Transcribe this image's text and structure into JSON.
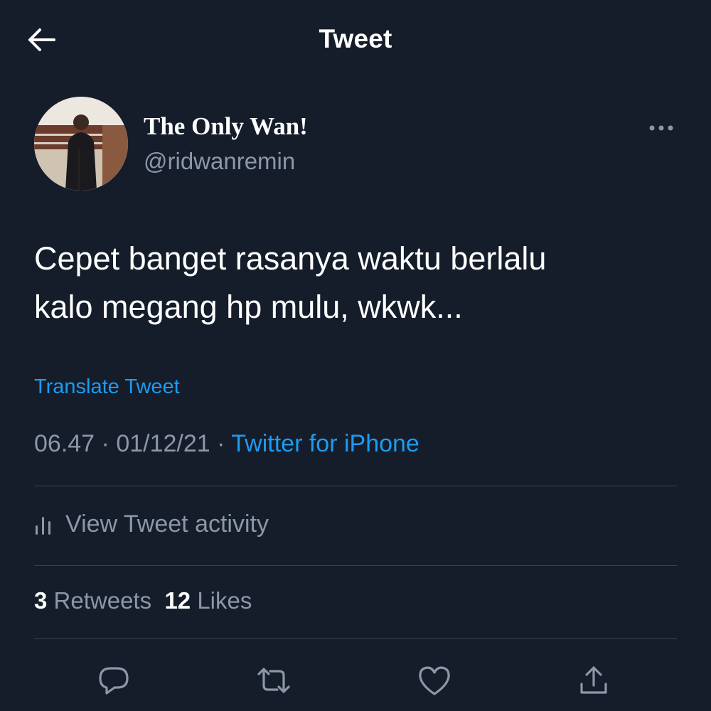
{
  "header": {
    "title": "Tweet",
    "back_icon": "arrow-left-icon"
  },
  "author": {
    "display_name": "The Only Wan!",
    "handle": "@ridwanremin",
    "more_icon": "more-horizontal-icon"
  },
  "tweet": {
    "text_line1": "Cepet banget rasanya waktu berlalu",
    "text_line2": "kalo megang hp mulu, wkwk...",
    "translate_label": "Translate Tweet",
    "time": "06.47",
    "date": "01/12/21",
    "separator": " · ",
    "client": "Twitter for iPhone"
  },
  "activity": {
    "label": "View Tweet activity",
    "icon": "bar-chart-icon"
  },
  "stats": {
    "retweets_count": "3",
    "retweets_label": "Retweets",
    "likes_count": "12",
    "likes_label": "Likes"
  },
  "actions": {
    "reply_icon": "reply-icon",
    "retweet_icon": "retweet-icon",
    "like_icon": "heart-icon",
    "share_icon": "share-icon"
  },
  "colors": {
    "background": "#151d2a",
    "accent": "#1d9bf0",
    "secondary_text": "#8b98a5",
    "divider": "#38444d"
  }
}
